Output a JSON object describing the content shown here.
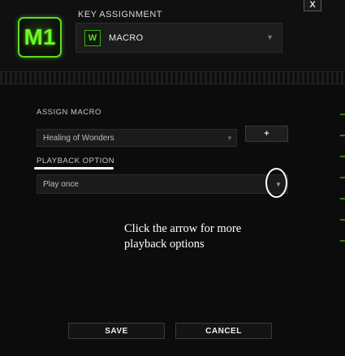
{
  "header": {
    "key_label": "M1",
    "title": "KEY ASSIGNMENT",
    "close_label": "X",
    "assignment": {
      "icon": "macro-icon",
      "icon_glyph": "W",
      "value": "MACRO",
      "arrow": "▼"
    }
  },
  "assign_macro": {
    "label": "ASSIGN MACRO",
    "selected": "Healing of Wonders",
    "arrow": "▼",
    "add_label": "+"
  },
  "playback_option": {
    "label": "PLAYBACK OPTION",
    "selected": "Play once",
    "arrow": "▼"
  },
  "annotation": {
    "line1": "Click the arrow for more",
    "line2": "playback options"
  },
  "footer": {
    "save_label": "SAVE",
    "cancel_label": "CANCEL"
  },
  "colors": {
    "accent": "#5fdc1e",
    "background": "#0c0c0c",
    "annotation": "#ffffff"
  }
}
